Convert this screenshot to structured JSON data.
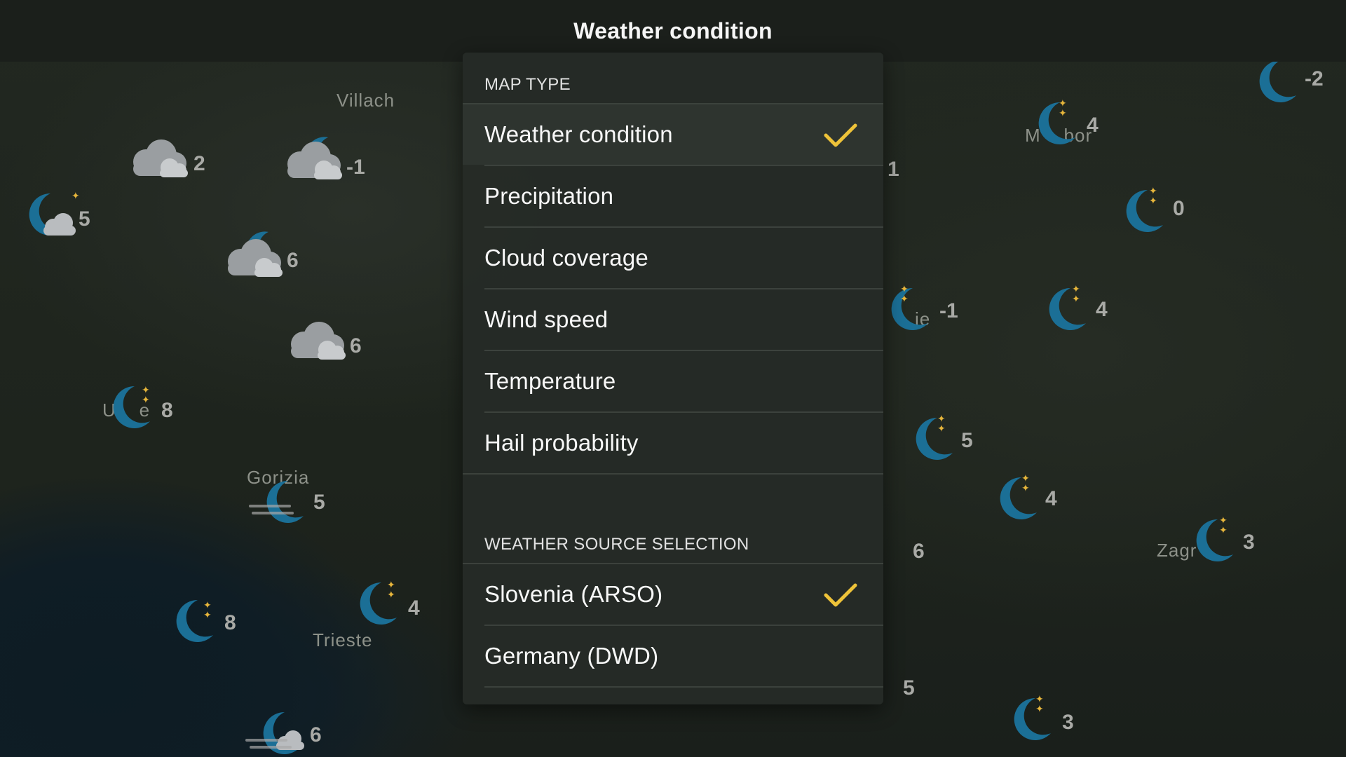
{
  "header": {
    "title": "Weather condition"
  },
  "map": {
    "cities": [
      {
        "name": "Villach"
      },
      {
        "name": "Gorizia"
      },
      {
        "name": "Trieste"
      },
      {
        "name": "Zagr"
      },
      {
        "name": "M    bor"
      },
      {
        "name": "je"
      },
      {
        "name": "U    e"
      }
    ],
    "markers": [
      {
        "icon": "cloud-icon",
        "value": "2"
      },
      {
        "icon": "cloud-moon-icon",
        "value": "-1"
      },
      {
        "icon": "moon-cloud-icon",
        "value": "5"
      },
      {
        "icon": "cloud-moon-icon",
        "value": "6"
      },
      {
        "icon": "cloud-icon",
        "value": "6"
      },
      {
        "icon": "moon-icon",
        "value": "8"
      },
      {
        "icon": "moon-fog-icon",
        "value": "5"
      },
      {
        "icon": "moon-icon",
        "value": "8"
      },
      {
        "icon": "moon-icon",
        "value": "4"
      },
      {
        "icon": "moon-fog-cloud-icon",
        "value": "6"
      },
      {
        "icon": "moon-icon",
        "value": "-2"
      },
      {
        "icon": "moon-icon",
        "value": "4"
      },
      {
        "icon": "moon-icon",
        "value": "0"
      },
      {
        "icon": "moon-icon",
        "value": "1"
      },
      {
        "icon": "moon-icon",
        "value": "-1"
      },
      {
        "icon": "moon-icon",
        "value": "4"
      },
      {
        "icon": "moon-icon",
        "value": "5"
      },
      {
        "icon": "moon-icon",
        "value": "4"
      },
      {
        "icon": "moon-icon",
        "value": "3"
      },
      {
        "icon": "moon-icon",
        "value": "6"
      },
      {
        "icon": "moon-icon",
        "value": "5"
      },
      {
        "icon": "moon-icon",
        "value": "3"
      }
    ]
  },
  "panel": {
    "map_type_header": "MAP TYPE",
    "map_types": [
      {
        "label": "Weather condition",
        "selected": true
      },
      {
        "label": "Precipitation",
        "selected": false
      },
      {
        "label": "Cloud coverage",
        "selected": false
      },
      {
        "label": "Wind speed",
        "selected": false
      },
      {
        "label": "Temperature",
        "selected": false
      },
      {
        "label": "Hail probability",
        "selected": false
      }
    ],
    "source_header": "WEATHER SOURCE SELECTION",
    "sources": [
      {
        "label": "Slovenia (ARSO)",
        "selected": true
      },
      {
        "label": "Germany (DWD)",
        "selected": false
      }
    ]
  },
  "colors": {
    "check": "#f5c93a",
    "moon": "#1b6f96",
    "cloud": "#b9bcbf",
    "panel": "#262b27"
  }
}
